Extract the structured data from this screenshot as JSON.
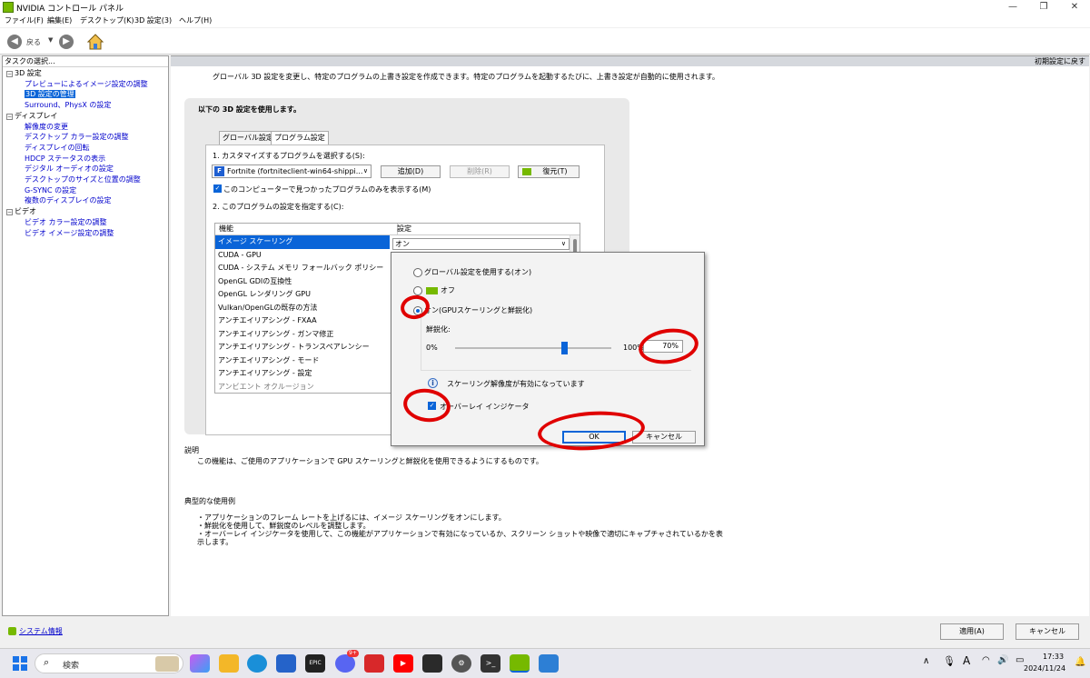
{
  "window": {
    "title": "NVIDIA コントロール パネル"
  },
  "menu": [
    "ファイル(F)",
    "編集(E)",
    "デスクトップ(K)",
    "3D 設定(3)",
    "ヘルプ(H)"
  ],
  "toolbar": {
    "back_label": "戻る"
  },
  "left_pane": {
    "header": "タスクの選択...",
    "tree": [
      {
        "label": "3D 設定",
        "level": 0
      },
      {
        "label": "プレビューによるイメージ設定の調整",
        "level": 1
      },
      {
        "label": "3D 設定の管理",
        "level": 1,
        "selected": true
      },
      {
        "label": "Surround、PhysX の設定",
        "level": 1
      },
      {
        "label": "ディスプレイ",
        "level": 0
      },
      {
        "label": "解像度の変更",
        "level": 1
      },
      {
        "label": "デスクトップ カラー設定の調整",
        "level": 1
      },
      {
        "label": "ディスプレイの回転",
        "level": 1
      },
      {
        "label": "HDCP ステータスの表示",
        "level": 1
      },
      {
        "label": "デジタル オーディオの設定",
        "level": 1
      },
      {
        "label": "デスクトップのサイズと位置の調整",
        "level": 1
      },
      {
        "label": "G-SYNC の設定",
        "level": 1
      },
      {
        "label": "複数のディスプレイの設定",
        "level": 1
      },
      {
        "label": "ビデオ",
        "level": 0
      },
      {
        "label": "ビデオ カラー設定の調整",
        "level": 1
      },
      {
        "label": "ビデオ イメージ設定の調整",
        "level": 1
      }
    ],
    "system_info": "システム情報"
  },
  "main": {
    "restore_defaults": "初期設定に戻す",
    "intro": "グローバル 3D 設定を変更し、特定のプログラムの上書き設定を作成できます。特定のプログラムを起動するたびに、上書き設定が自動的に使用されます。",
    "section_title": "以下の 3D 設定を使用します。",
    "tabs": [
      "グローバル設定",
      "プログラム設定"
    ],
    "step1": "1. カスタマイズするプログラムを選択する(S):",
    "program_selected": "Fortnite (fortniteclient-win64-shippi...",
    "add_button": "追加(D)",
    "remove_button": "削除(R)",
    "restore_button": "復元(T)",
    "show_only_found": "このコンピューターで見つかったプログラムのみを表示する(M)",
    "step2": "2. このプログラムの設定を指定する(C):",
    "table": {
      "col_feature": "機能",
      "col_setting": "設定",
      "rows": [
        "イメージ スケーリング",
        "CUDA - GPU",
        "CUDA - システム メモリ フォールバック ポリシー",
        "OpenGL GDIの互換性",
        "OpenGL レンダリング GPU",
        "Vulkan/OpenGLの既存の方法",
        "アンチエイリアシング - FXAA",
        "アンチエイリアシング - ガンマ修正",
        "アンチエイリアシング - トランスペアレンシー",
        "アンチエイリアシング - モード",
        "アンチエイリアシング - 設定",
        "アンビエント オクルージョン"
      ],
      "selected_value": "オン"
    },
    "description_heading": "説明",
    "description": "この機能は、ご使用のアプリケーションで GPU スケーリングと鮮鋭化を使用できるようにするものです。",
    "usage_heading": "典型的な使用例",
    "usage": [
      "・アプリケーションのフレーム レートを上げるには、イメージ スケーリングをオンにします。",
      "・鮮鋭化を使用して、鮮鋭度のレベルを調整します。",
      "・オーバーレイ インジケータを使用して、この機能がアプリケーションで有効になっているか、スクリーン ショットや映像で適切にキャプチャされているかを表",
      "  示します。"
    ]
  },
  "popup": {
    "opt_global": "グローバル設定を使用する(オン)",
    "opt_off": "オフ",
    "opt_on": "オン(GPUスケーリングと鮮鋭化)",
    "sharpen_label": "鮮鋭化:",
    "min_label": "0%",
    "max_label": "100%",
    "sharpen_value": "70%",
    "sharpen_level": 0.7,
    "info_text": "スケーリング解像度が有効になっています",
    "overlay_label": "オーバーレイ インジケータ",
    "ok": "OK",
    "cancel": "キャンセル"
  },
  "footer": {
    "apply": "適用(A)",
    "cancel": "キャンセル"
  },
  "taskbar": {
    "search": "検索",
    "time": "17:33",
    "date": "2024/11/24",
    "badge": "9+",
    "ime": "A"
  },
  "colors": {
    "nvidia_green": "#76b900",
    "selection_blue": "#0a64d8",
    "annotation_red": "#e00000"
  }
}
